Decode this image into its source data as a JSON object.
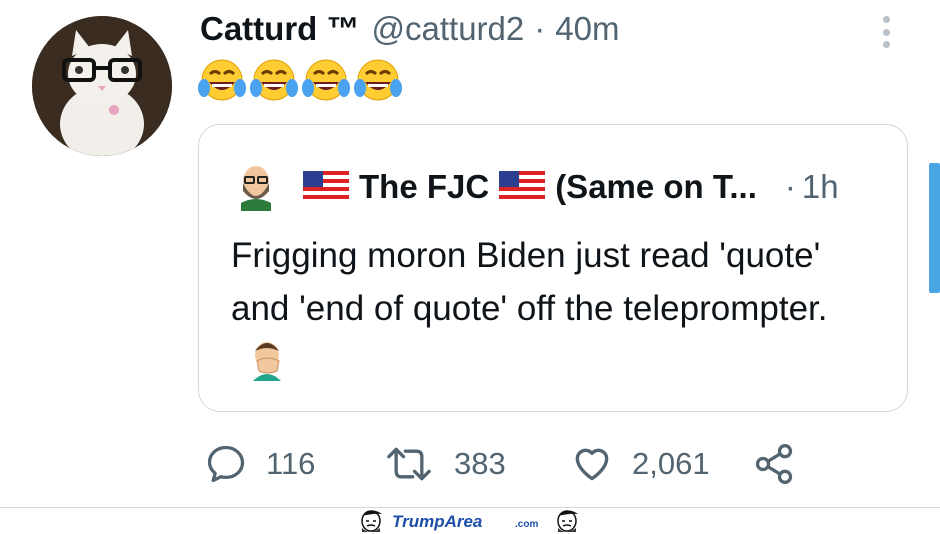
{
  "author": {
    "name": "Catturd ™",
    "handle": "@catturd2",
    "separator": "·",
    "time": "40m",
    "avatar_icon": "white-cat-with-glasses-avatar"
  },
  "tweet": {
    "emojis": [
      "face-with-tears-of-joy-icon",
      "face-with-tears-of-joy-icon",
      "face-with-tears-of-joy-icon",
      "face-with-tears-of-joy-icon"
    ]
  },
  "quoted": {
    "name": "The FJC",
    "name_suffix": "(Same on T...",
    "separator": "·",
    "time": "1h",
    "text": "Frigging moron Biden just read 'quote' and 'end of quote' off the teleprompter.",
    "avatar_icon": "bearded-man-cartoon-avatar",
    "flag_icon": "us-flag-icon",
    "end_emoji": "man-facepalming-icon"
  },
  "actions": {
    "reply_count": "116",
    "retweet_count": "383",
    "like_count": "2,061"
  },
  "watermark": {
    "brand_main": "TrumpArea",
    "brand_suffix": ".com"
  },
  "colors": {
    "text": "#0f1419",
    "muted": "#536471",
    "border": "#cfd9de",
    "scrollbar": "#4aa7e6",
    "watermark_blue": "#1e4fa8",
    "watermark_red": "#c8102e"
  }
}
